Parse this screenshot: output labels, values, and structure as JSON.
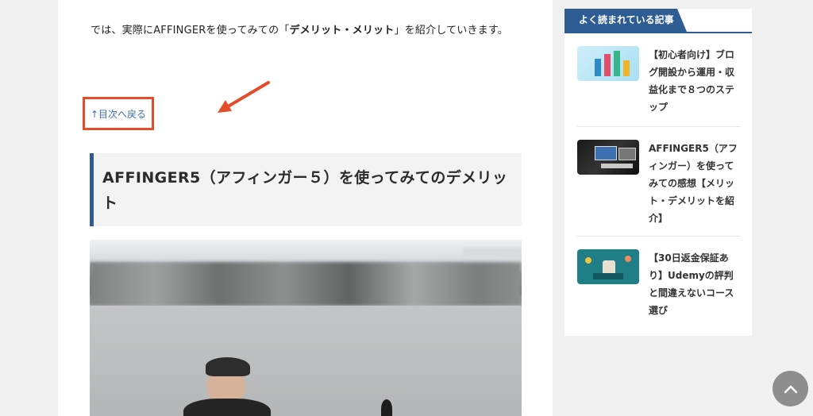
{
  "article": {
    "intro_prefix": "では、実際にAFFINGERを使ってみての「",
    "intro_bold": "デメリット・メリット",
    "intro_suffix": "」を紹介していきます。",
    "toc_back_label": "↑目次へ戻る",
    "heading": "AFFINGER5（アフィンガー５）を使ってみてのデメリット"
  },
  "sidebar": {
    "title": "よく読まれている記事",
    "posts": [
      {
        "title": "【初心者向け】ブログ開設から運用・収益化まで８つのステップ"
      },
      {
        "title": "AFFINGER5（アフィンガー）を使ってみての感想【メリット・デメリットを紹介】"
      },
      {
        "title": "【30日返金保証あり】Udemyの評判と間違えないコース選び"
      }
    ]
  },
  "colors": {
    "accent": "#2e5d94",
    "highlight_box": "#e34d2a",
    "link": "#3e6ea8"
  },
  "icons": {
    "scroll_top": "chevron-up-icon",
    "annotation": "arrow-icon"
  }
}
